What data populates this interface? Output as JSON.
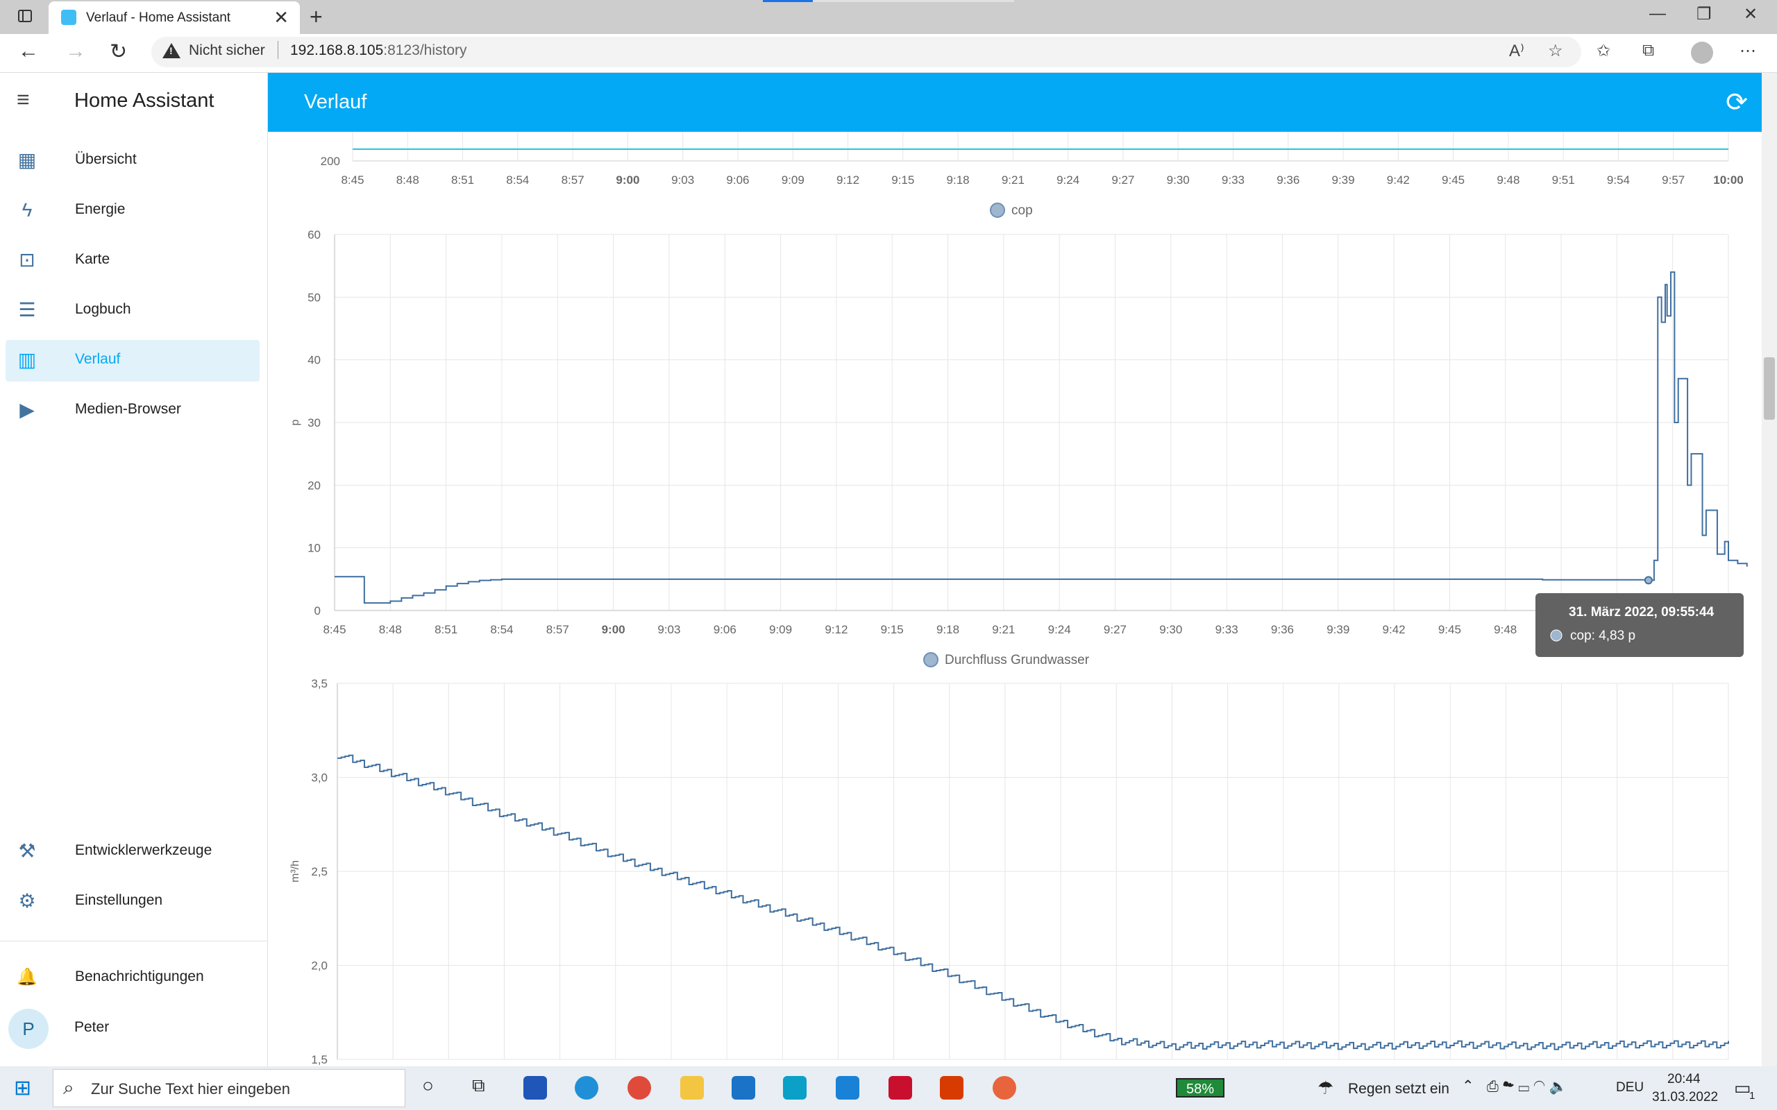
{
  "browser": {
    "tab_title": "Verlauf - Home Assistant",
    "tab_close": "✕",
    "new_tab": "+",
    "back": "←",
    "forward": "→",
    "reload": "↻",
    "not_secure": "Nicht sicher",
    "url_host": "192.168.8.105",
    "url_rest": ":8123/history",
    "win_min": "—",
    "win_max": "❐",
    "win_close": "✕",
    "tools": [
      "A⁾",
      "☆",
      "✩",
      "⧉",
      "⋯"
    ]
  },
  "sidebar": {
    "menu_icon": "≡",
    "title": "Home Assistant",
    "items": [
      {
        "label": "Übersicht",
        "icon": "dashboard-icon",
        "glyph": "▦"
      },
      {
        "label": "Energie",
        "icon": "lightning-icon",
        "glyph": "ϟ"
      },
      {
        "label": "Karte",
        "icon": "map-account-icon",
        "glyph": "⊡"
      },
      {
        "label": "Logbuch",
        "icon": "list-icon",
        "glyph": "☰"
      },
      {
        "label": "Verlauf",
        "icon": "chart-box-icon",
        "glyph": "▥"
      },
      {
        "label": "Medien-Browser",
        "icon": "play-box-icon",
        "glyph": "▶"
      }
    ],
    "bottom_items": [
      {
        "label": "Entwicklerwerkzeuge",
        "icon": "hammer-icon",
        "glyph": "⚒"
      },
      {
        "label": "Einstellungen",
        "icon": "gear-icon",
        "glyph": "⚙"
      }
    ],
    "notifications": {
      "label": "Benachrichtigungen",
      "glyph": "🔔"
    },
    "user": {
      "initial": "P",
      "name": "Peter"
    }
  },
  "header": {
    "title": "Verlauf",
    "refresh_glyph": "⟳"
  },
  "colors": {
    "accent": "#03a9f4",
    "line": "#3e6fa0",
    "cyan": "#26c6da",
    "tooltip": "#626262"
  },
  "chart_data": [
    {
      "type": "line",
      "title": "",
      "partial": true,
      "y_ticks_visible": [
        "200"
      ],
      "x_ticks": [
        "8:45",
        "8:48",
        "8:51",
        "8:54",
        "8:57",
        "9:00",
        "9:03",
        "9:06",
        "9:09",
        "9:12",
        "9:15",
        "9:18",
        "9:21",
        "9:24",
        "9:27",
        "9:30",
        "9:33",
        "9:36",
        "9:39",
        "9:42",
        "9:45",
        "9:48",
        "9:51",
        "9:54",
        "9:57",
        "10:00"
      ]
    },
    {
      "type": "line",
      "series": [
        {
          "name": "cop"
        }
      ],
      "ylabel": "p",
      "ylim": [
        0,
        60
      ],
      "y_ticks": [
        "0",
        "10",
        "20",
        "30",
        "40",
        "50",
        "60"
      ],
      "x_ticks": [
        "8:45",
        "8:48",
        "8:51",
        "8:54",
        "8:57",
        "9:00",
        "9:03",
        "9:06",
        "9:09",
        "9:12",
        "9:15",
        "9:18",
        "9:21",
        "9:24",
        "9:27",
        "9:30",
        "9:33",
        "9:36",
        "9:39",
        "9:42",
        "9:45",
        "9:48",
        "9:51",
        "9:54",
        "9:57",
        "10:00"
      ],
      "points": [
        [
          0,
          5.4
        ],
        [
          1.5,
          5.4
        ],
        [
          1.6,
          1.2
        ],
        [
          2.5,
          1.2
        ],
        [
          3.0,
          1.5
        ],
        [
          3.6,
          2.0
        ],
        [
          4.2,
          2.4
        ],
        [
          4.8,
          2.8
        ],
        [
          5.4,
          3.3
        ],
        [
          6.0,
          3.9
        ],
        [
          6.6,
          4.3
        ],
        [
          7.2,
          4.6
        ],
        [
          7.8,
          4.8
        ],
        [
          8.4,
          4.9
        ],
        [
          9.0,
          5.0
        ],
        [
          10,
          5.0
        ],
        [
          12,
          5.0
        ],
        [
          15,
          5.0
        ],
        [
          20,
          5.0
        ],
        [
          30,
          5.0
        ],
        [
          40,
          5.0
        ],
        [
          50,
          5.0
        ],
        [
          60,
          5.0
        ],
        [
          65,
          4.9
        ],
        [
          70.7,
          4.83
        ],
        [
          71.0,
          8.0
        ],
        [
          71.2,
          50
        ],
        [
          71.4,
          46
        ],
        [
          71.6,
          52
        ],
        [
          71.7,
          47
        ],
        [
          71.9,
          54
        ],
        [
          72.1,
          30
        ],
        [
          72.3,
          37
        ],
        [
          72.6,
          37
        ],
        [
          72.8,
          20
        ],
        [
          73.0,
          25
        ],
        [
          73.4,
          25
        ],
        [
          73.6,
          12
        ],
        [
          73.8,
          16
        ],
        [
          74.2,
          16
        ],
        [
          74.4,
          9
        ],
        [
          74.8,
          11
        ],
        [
          75.0,
          8
        ],
        [
          75.5,
          7.5
        ],
        [
          76.0,
          7.0
        ]
      ],
      "x_range": [
        0,
        75
      ],
      "x_unit": "minutes since 8:45",
      "tooltip": {
        "title": "31. März 2022, 09:55:44",
        "text": "cop: 4,83 p"
      }
    },
    {
      "type": "line",
      "series": [
        {
          "name": "Durchfluss Grundwasser"
        }
      ],
      "ylabel": "m³/h",
      "ylim": [
        1.5,
        3.5
      ],
      "y_ticks": [
        "1,5",
        "2,0",
        "2,5",
        "3,0",
        "3,5"
      ],
      "points": [
        [
          0,
          3.12
        ],
        [
          3,
          3.02
        ],
        [
          6,
          2.92
        ],
        [
          9,
          2.8
        ],
        [
          12,
          2.7
        ],
        [
          15,
          2.58
        ],
        [
          18,
          2.48
        ],
        [
          21,
          2.38
        ],
        [
          24,
          2.28
        ],
        [
          27,
          2.18
        ],
        [
          30,
          2.07
        ],
        [
          33,
          1.95
        ],
        [
          36,
          1.82
        ],
        [
          39,
          1.7
        ],
        [
          42,
          1.6
        ],
        [
          45,
          1.57
        ],
        [
          50,
          1.58
        ],
        [
          55,
          1.57
        ],
        [
          60,
          1.58
        ],
        [
          65,
          1.57
        ],
        [
          70,
          1.58
        ],
        [
          75,
          1.58
        ]
      ],
      "x_range": [
        0,
        75
      ]
    }
  ],
  "taskbar": {
    "search_placeholder": "Zur Suche Text hier eingeben",
    "battery": "58%",
    "weather": "Regen setzt ein",
    "lang": "DEU",
    "time": "20:44",
    "date": "31.03.2022",
    "notif_count": "1"
  }
}
